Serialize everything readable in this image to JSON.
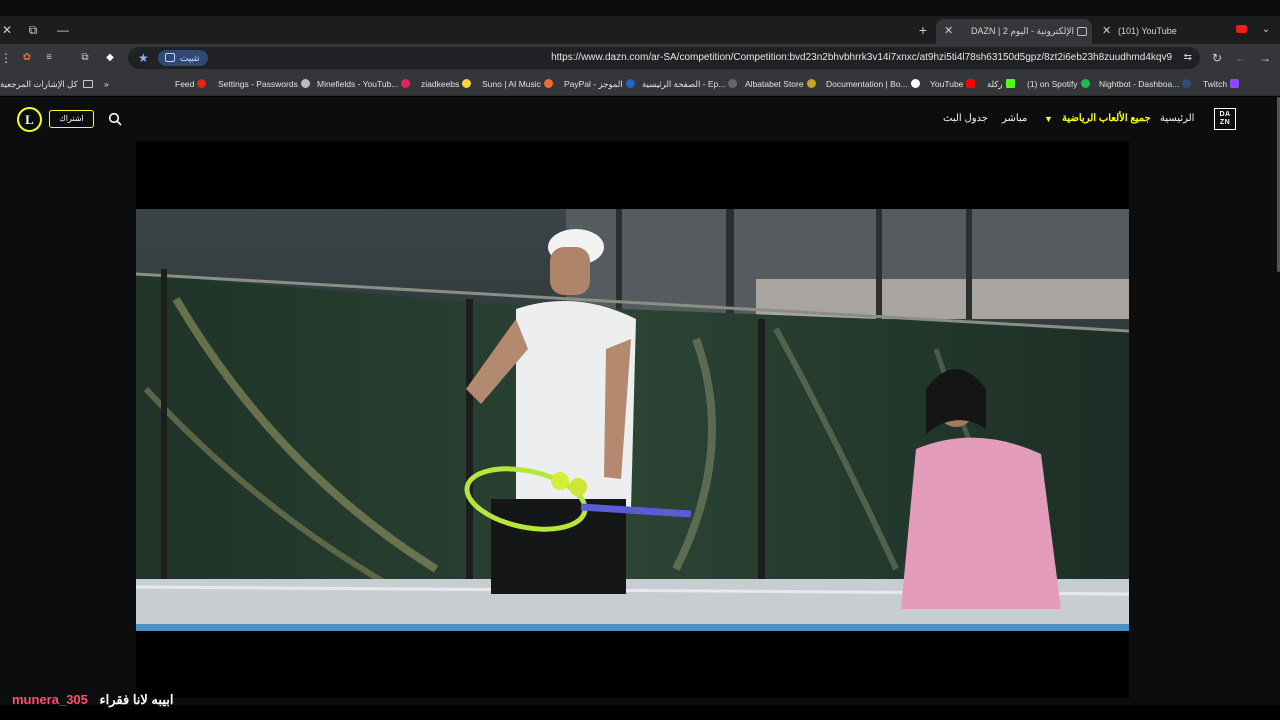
{
  "browser": {
    "tabs": [
      {
        "label": "(101) YouTube",
        "active": false
      },
      {
        "label": "DAZN | الإلكترونية - اليوم 2",
        "active": true
      }
    ],
    "window_controls": {
      "close": "✕",
      "restore": "⧉",
      "minimize": "—"
    },
    "new_tab": "+",
    "url": "https://www.dazn.com/ar-SA/competition/Competition:bvd23n2bhvbhrrk3v14i7xnxc/at9hzi5ti4l78sh63150d5gpz/8zt2i6eb23h8zuudhmd4kqv9",
    "install_button": "تثبيت",
    "bookmarks": [
      {
        "label": "Twitch",
        "color": "#9146ff"
      },
      {
        "label": "Nightbot - Dashboa...",
        "color": "#2b4f7a"
      },
      {
        "label": "(1) on Spotify",
        "color": "#1db954"
      },
      {
        "label": "ركلة",
        "color": "#53fc18"
      },
      {
        "label": "YouTube",
        "color": "#ff0000"
      },
      {
        "label": "Documentation | Bo...",
        "color": "#ffffff"
      },
      {
        "label": "Albatabet Store",
        "color": "#c9a227"
      },
      {
        "label": "الصفحة الرئيسية - Ep...",
        "color": "#666666"
      },
      {
        "label": "PayPal - الموجز",
        "color": "#1f66c2"
      },
      {
        "label": "Suno | AI Music",
        "color": "#f26b3a"
      },
      {
        "label": "ziadkeebs",
        "color": "#ffd23f"
      },
      {
        "label": "Minefields - YouTub...",
        "color": "#e0245e"
      },
      {
        "label": "Settings - Passwords",
        "color": "#bbbbbb"
      },
      {
        "label": "Feed",
        "color": "#e62117"
      }
    ],
    "bookmarks_folder": "كل الإشارات المرجعية",
    "bookmarks_more": "»"
  },
  "dazn": {
    "logo_top": "DA",
    "logo_bottom": "ZN",
    "nav": {
      "home": "الرئيسية",
      "all_sports": "جميع الألعاب الرياضية",
      "live": "مباشر",
      "schedule": "جدول البث"
    },
    "subscribe": "اشتراك",
    "profile_initial": "L",
    "accent_color": "#f7ff1a"
  },
  "overlay": {
    "username": "munera_305",
    "message": "ابيبه لانا فقراء"
  }
}
